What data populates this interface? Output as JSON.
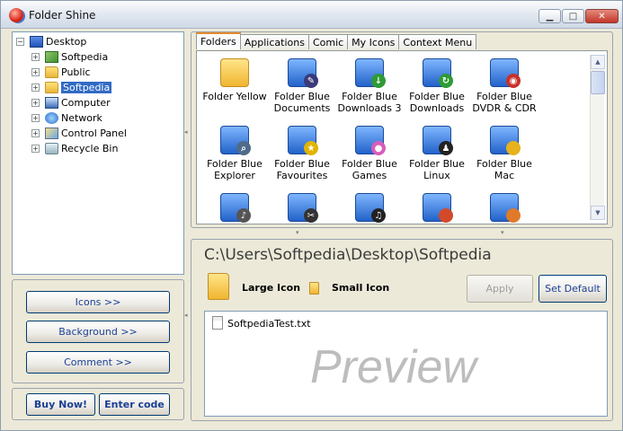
{
  "window": {
    "title": "Folder Shine",
    "minimize": "▁",
    "maximize": "□",
    "close": "✕"
  },
  "tree": [
    {
      "label": "Desktop",
      "icon": "desktop-icon",
      "expander": "−",
      "selected": false
    },
    {
      "label": "Softpedia",
      "icon": "softpedia-folder-icon",
      "expander": "+",
      "selected": false
    },
    {
      "label": "Public",
      "icon": "folder-icon",
      "expander": "+",
      "selected": false
    },
    {
      "label": "Softpedia",
      "icon": "folder-icon",
      "expander": "+",
      "selected": true
    },
    {
      "label": "Computer",
      "icon": "computer-icon",
      "expander": "+",
      "selected": false
    },
    {
      "label": "Network",
      "icon": "network-icon",
      "expander": "+",
      "selected": false
    },
    {
      "label": "Control Panel",
      "icon": "control-panel-icon",
      "expander": "+",
      "selected": false
    },
    {
      "label": "Recycle Bin",
      "icon": "recycle-bin-icon",
      "expander": "+",
      "selected": false
    }
  ],
  "side_buttons": {
    "icons": "Icons >>",
    "background": "Background >>",
    "comment": "Comment >>"
  },
  "bottom_buttons": {
    "buy": "Buy Now!",
    "enter_code": "Enter code"
  },
  "tabs": [
    "Folders",
    "Applications",
    "Comic",
    "My Icons",
    "Context Menu"
  ],
  "active_tab": "Folders",
  "icons": [
    {
      "label": "Folder Yellow",
      "icon": "folder-yellow-icon",
      "badge": "",
      "badge_color": ""
    },
    {
      "label": "Folder Blue Documents",
      "icon": "folder-blue-documents-icon",
      "badge": "✎",
      "badge_color": "#3a3a7a"
    },
    {
      "label": "Folder Blue Downloads 3",
      "icon": "folder-blue-downloads3-icon",
      "badge": "↓",
      "badge_color": "#2e9b35"
    },
    {
      "label": "Folder Blue Downloads",
      "icon": "folder-blue-downloads-icon",
      "badge": "↻",
      "badge_color": "#2e9b35"
    },
    {
      "label": "Folder Blue DVDR & CDR",
      "icon": "folder-blue-dvdr-icon",
      "badge": "◉",
      "badge_color": "#c8322a"
    },
    {
      "label": "Folder Blue Explorer",
      "icon": "folder-blue-explorer-icon",
      "badge": "⌕",
      "badge_color": "#4f6b8a"
    },
    {
      "label": "Folder Blue Favourites",
      "icon": "folder-blue-favourites-icon",
      "badge": "★",
      "badge_color": "#e0b400"
    },
    {
      "label": "Folder Blue Games",
      "icon": "folder-blue-games-icon",
      "badge": "●",
      "badge_color": "#d85dbb"
    },
    {
      "label": "Folder Blue Linux",
      "icon": "folder-blue-linux-icon",
      "badge": "♟",
      "badge_color": "#222222"
    },
    {
      "label": "Folder Blue Mac",
      "icon": "folder-blue-mac-icon",
      "badge": "",
      "badge_color": "#e8b21c"
    },
    {
      "label": "",
      "icon": "folder-blue-music-icon",
      "badge": "♪",
      "badge_color": "#555555"
    },
    {
      "label": "",
      "icon": "folder-blue-movies-icon",
      "badge": "✂",
      "badge_color": "#333333"
    },
    {
      "label": "",
      "icon": "folder-blue-music2-icon",
      "badge": "♫",
      "badge_color": "#222222"
    },
    {
      "label": "",
      "icon": "folder-blue-contacts-icon",
      "badge": "",
      "badge_color": "#d24a2a"
    },
    {
      "label": "",
      "icon": "folder-blue-pictures-icon",
      "badge": "",
      "badge_color": "#e07a2a"
    }
  ],
  "preview": {
    "path": "C:\\Users\\Softpedia\\Desktop\\Softpedia",
    "large_icon": "Large Icon",
    "small_icon": "Small Icon",
    "apply": "Apply",
    "set_default": "Set Default",
    "file": "SoftpediaTest.txt",
    "watermark": "Preview"
  },
  "colors": {
    "selection": "#316ac5",
    "title_accent": "#c8322a",
    "tab_accent": "#e68b2c"
  }
}
